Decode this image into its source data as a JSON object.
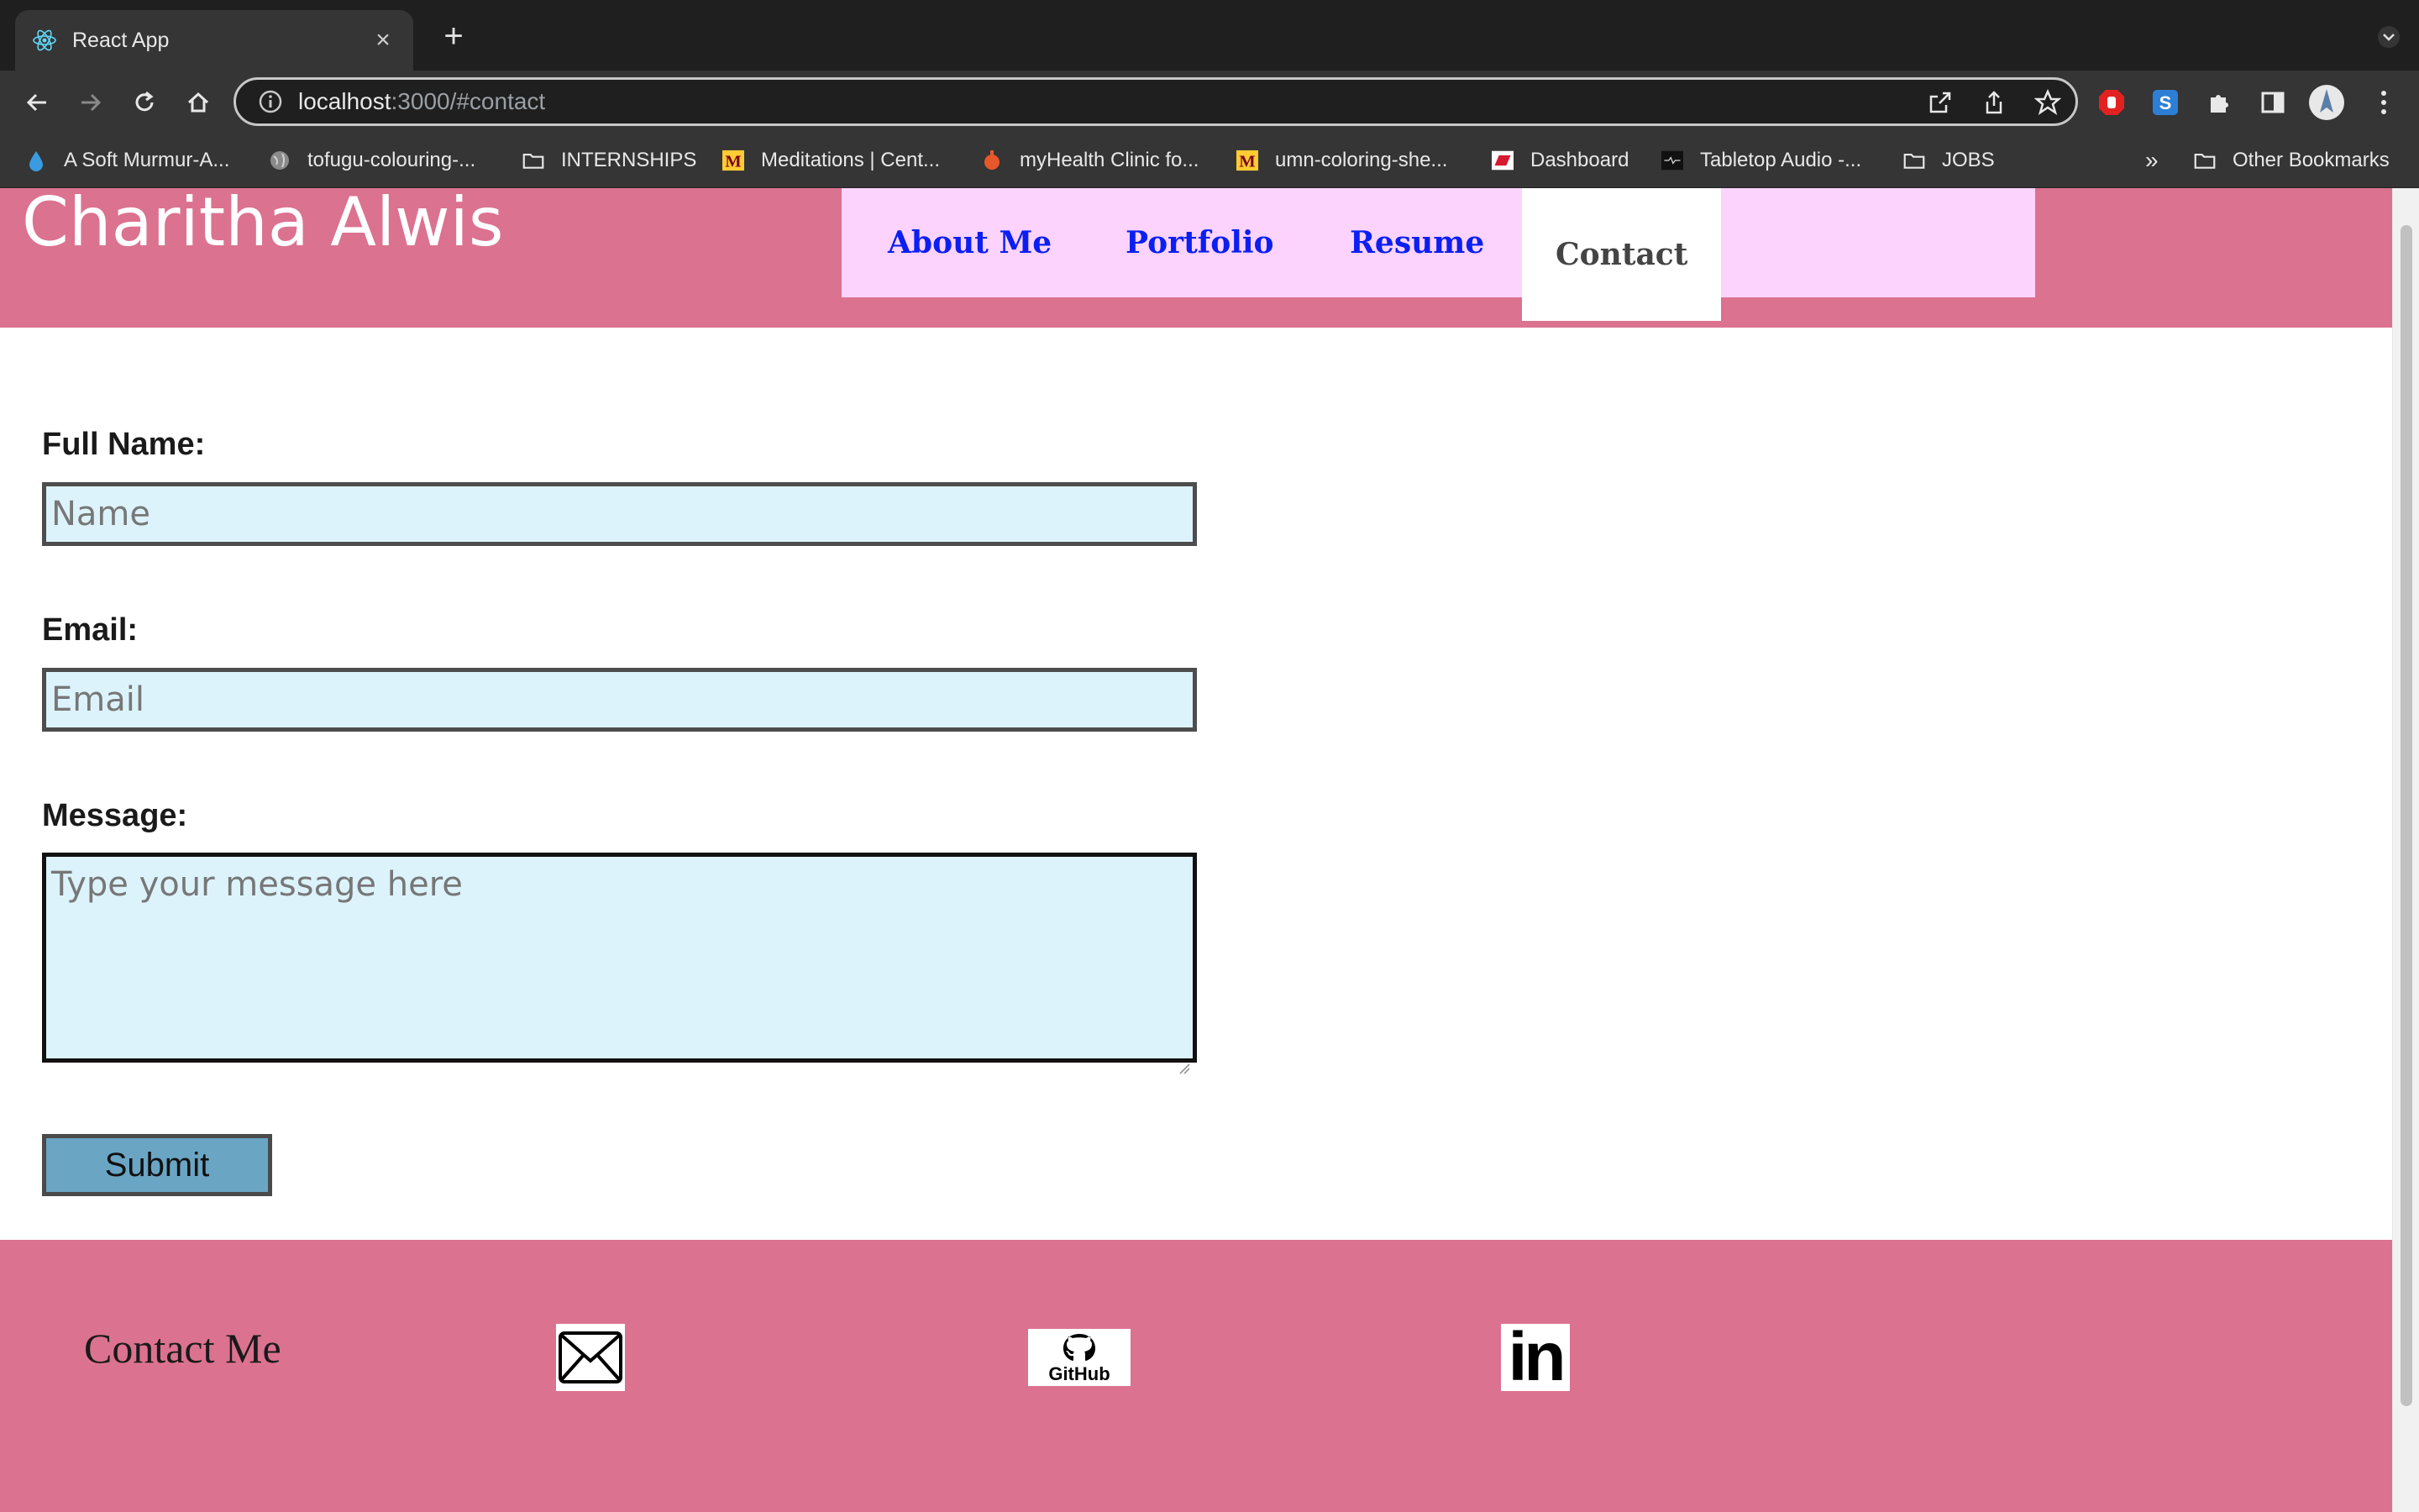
{
  "browser": {
    "tab_title": "React App",
    "url_host": "localhost",
    "url_rest": ":3000/#contact",
    "bookmarks": [
      "A Soft Murmur-A...",
      "tofugu-colouring-...",
      "INTERNSHIPS",
      "Meditations | Cent...",
      "myHealth Clinic fo...",
      "umn-coloring-she...",
      "Dashboard",
      "Tabletop Audio -...",
      "JOBS"
    ],
    "overflow_label": "»",
    "other_bookmarks": "Other Bookmarks"
  },
  "site": {
    "title": "Charitha Alwis",
    "nav": [
      "About Me",
      "Portfolio",
      "Resume",
      "Contact"
    ],
    "active_nav": "Contact"
  },
  "form": {
    "name_label": "Full Name:",
    "name_placeholder": "Name",
    "email_label": "Email:",
    "email_placeholder": "Email",
    "message_label": "Message:",
    "message_placeholder": "Type your message here",
    "submit_label": "Submit"
  },
  "footer": {
    "contact_title": "Contact Me",
    "github_label": "GitHub",
    "linkedin_label": "in"
  },
  "colors": {
    "header_pink": "#db7290",
    "nav_bg": "#fcd3fc",
    "nav_link": "#0b1ff2",
    "input_bg": "#dcf3fc",
    "submit_bg": "#6aa5c4"
  },
  "icons": [
    "react-icon",
    "close-icon",
    "plus-icon",
    "back-icon",
    "forward-icon",
    "reload-icon",
    "home-icon",
    "info-icon",
    "open-external-icon",
    "share-icon",
    "star-icon",
    "extension-icon",
    "sidebar-icon",
    "profile-icon",
    "menu-icon",
    "folder-icon",
    "mail-icon",
    "github-icon",
    "linkedin-icon"
  ]
}
